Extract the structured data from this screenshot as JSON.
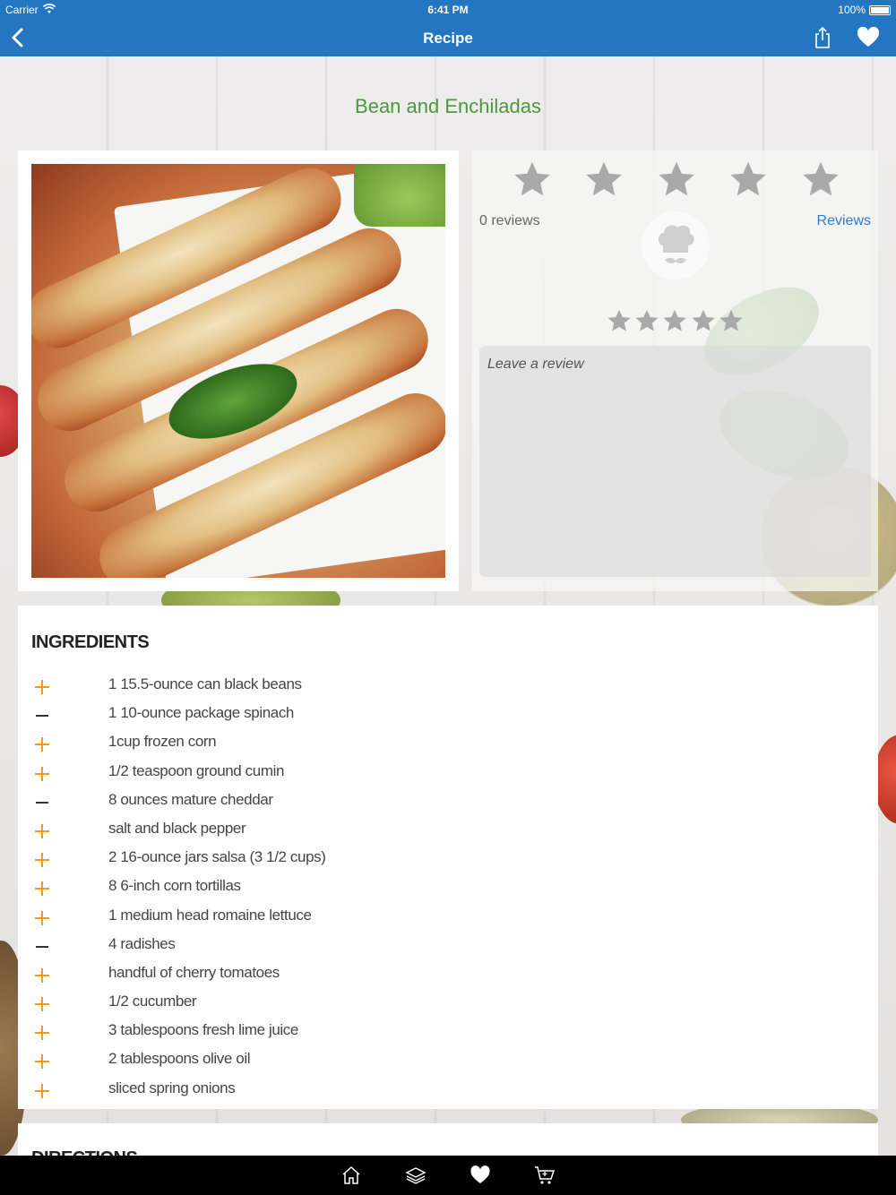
{
  "status_bar": {
    "carrier": "Carrier",
    "time": "6:41 PM",
    "battery": "100%"
  },
  "nav": {
    "title": "Recipe"
  },
  "recipe": {
    "title": "Bean and Enchiladas"
  },
  "rating": {
    "reviews_count": "0 reviews",
    "reviews_link": "Reviews",
    "review_placeholder": "Leave a review"
  },
  "ingredients": {
    "heading": "INGREDIENTS",
    "items": [
      {
        "text": "1 15.5-ounce can black beans",
        "marker": "plus"
      },
      {
        "text": "1 10-ounce package spinach",
        "marker": "minus"
      },
      {
        "text": "1cup frozen corn",
        "marker": "plus"
      },
      {
        "text": "1/2 teaspoon ground cumin",
        "marker": "plus"
      },
      {
        "text": "8 ounces mature cheddar",
        "marker": "minus"
      },
      {
        "text": "salt and black pepper",
        "marker": "plus"
      },
      {
        "text": "2 16-ounce jars salsa (3 1/2 cups)",
        "marker": "plus"
      },
      {
        "text": "8 6-inch corn tortillas",
        "marker": "plus"
      },
      {
        "text": "1 medium head romaine lettuce",
        "marker": "plus"
      },
      {
        "text": "4 radishes",
        "marker": "minus"
      },
      {
        "text": "handful of cherry tomatoes",
        "marker": "plus"
      },
      {
        "text": "1/2 cucumber",
        "marker": "plus"
      },
      {
        "text": "3 tablespoons fresh lime juice",
        "marker": "plus"
      },
      {
        "text": "2 tablespoons olive oil",
        "marker": "plus"
      },
      {
        "text": "sliced spring onions",
        "marker": "plus"
      }
    ]
  },
  "directions": {
    "heading": "DIRECTIONS"
  },
  "tabbar": {
    "icons": [
      "home-icon",
      "layers-icon",
      "heart-icon",
      "cart-icon"
    ]
  },
  "colors": {
    "nav_blue": "#2476c0",
    "title_green": "#4a9a3a",
    "accent_orange": "#f39a1e",
    "link_blue": "#2e7bd2",
    "star_gray": "#a9a9a9"
  }
}
